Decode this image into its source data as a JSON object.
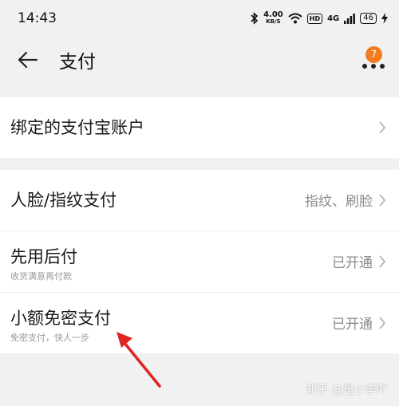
{
  "status_bar": {
    "time": "14:43",
    "network_speed": "4.00",
    "network_speed_unit": "KB/S",
    "hd_badge": "HD",
    "signal_label": "4G",
    "battery": "46",
    "icons": [
      "bluetooth-icon",
      "wifi-icon",
      "signal-icon",
      "battery-icon",
      "charging-icon"
    ]
  },
  "header": {
    "title": "支付",
    "more_badge_count": "7"
  },
  "sections": {
    "alipay": {
      "label": "绑定的支付宝账户"
    },
    "face_fingerprint": {
      "label": "人脸/指纹支付",
      "value": "指纹、刷脸"
    },
    "pay_later": {
      "label": "先用后付",
      "subtitle": "收货满意再付款",
      "value": "已开通"
    },
    "small_amount": {
      "label": "小额免密支付",
      "subtitle": "免密支付，快人一步",
      "value": "已开通"
    }
  },
  "watermark": "知乎 @是小李吖",
  "colors": {
    "badge": "#f47b20",
    "annotation_arrow": "#e02424",
    "background": "#f1f1f1"
  }
}
